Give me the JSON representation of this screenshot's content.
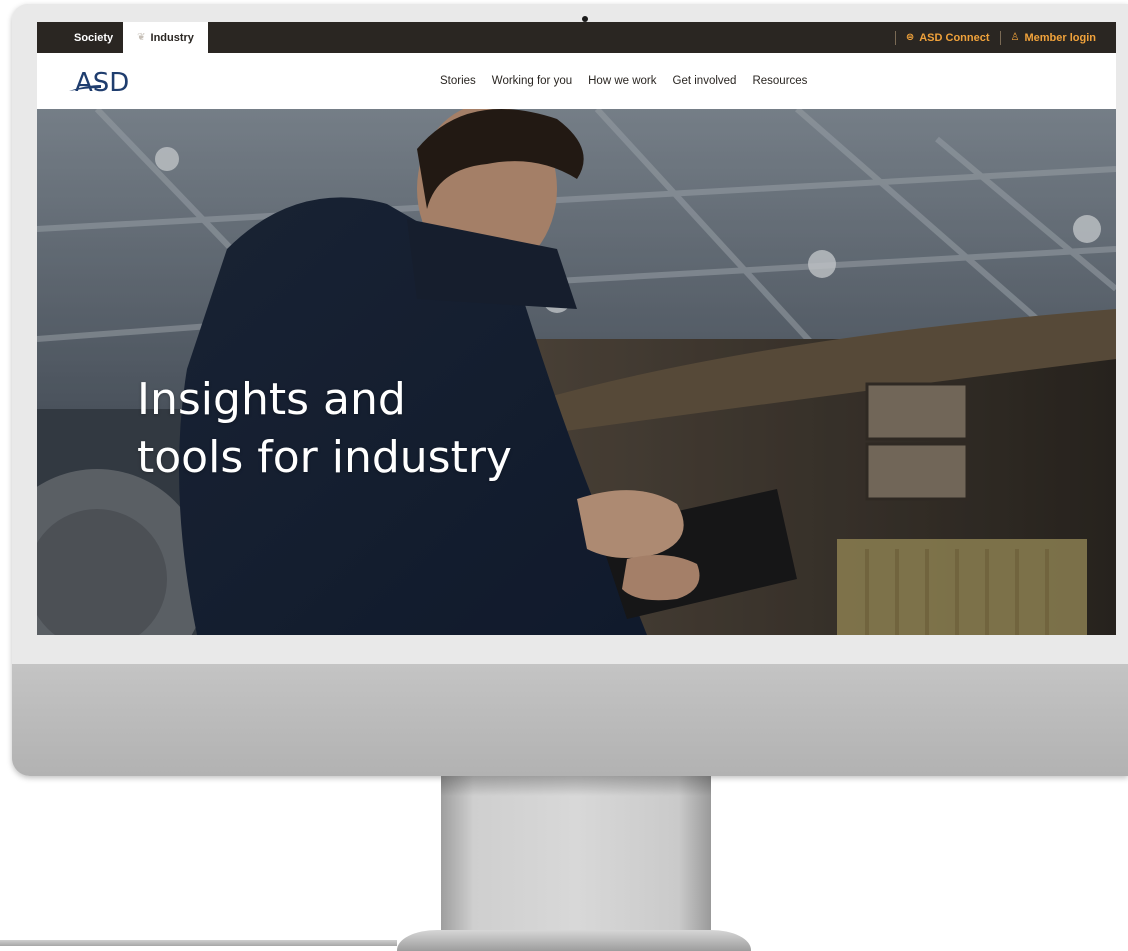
{
  "topbar": {
    "tabs": [
      {
        "label": "Society",
        "active": false
      },
      {
        "label": "Industry",
        "active": true,
        "icon": "leaf-icon"
      }
    ],
    "links": [
      {
        "label": "ASD Connect",
        "icon": "connect-icon"
      },
      {
        "label": "Member login",
        "icon": "user-icon"
      }
    ]
  },
  "header": {
    "logo_text": "ASD",
    "nav": [
      "Stories",
      "Working for you",
      "How we work",
      "Get involved",
      "Resources"
    ]
  },
  "hero": {
    "title_line1": "Insights and",
    "title_line2": "tools for industry"
  },
  "colors": {
    "topbar_bg": "#2a2622",
    "accent": "#f0a23b",
    "logo_blue": "#1f3d6e"
  }
}
